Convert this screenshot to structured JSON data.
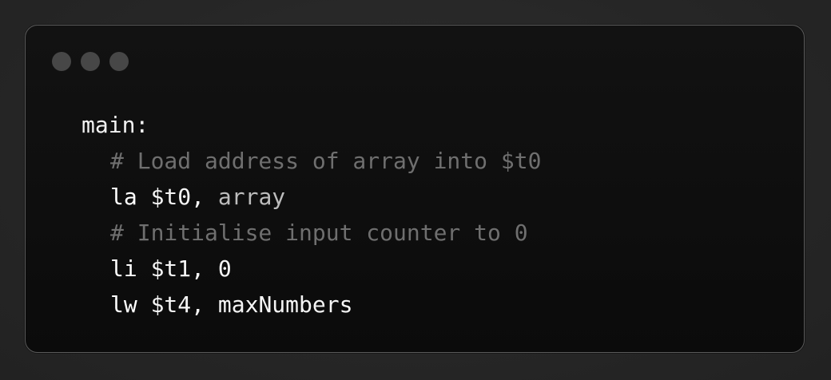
{
  "window": {
    "controls": [
      {
        "name": "window-control-1",
        "color": "#474747"
      },
      {
        "name": "window-control-2",
        "color": "#474747"
      },
      {
        "name": "window-control-3",
        "color": "#474747"
      }
    ]
  },
  "code": {
    "language": "MIPS assembly",
    "lines": [
      {
        "label": "main:"
      },
      {
        "comment": "# Load address of array into $t0"
      },
      {
        "instruction": "la",
        "operands": "$t0, ",
        "arg": "array"
      },
      {
        "comment": "# Initialise input counter to 0"
      },
      {
        "instruction": "li",
        "operands": "$t1, 0"
      },
      {
        "instruction": "lw",
        "operands": "$t4, maxNumbers"
      }
    ]
  },
  "colors": {
    "background": "#262626",
    "window": "#0d0d0d",
    "border": "#5a5a5a",
    "comment": "#6f6f6f",
    "text": "#f2f2f2",
    "argument": "#bdbdbd"
  }
}
